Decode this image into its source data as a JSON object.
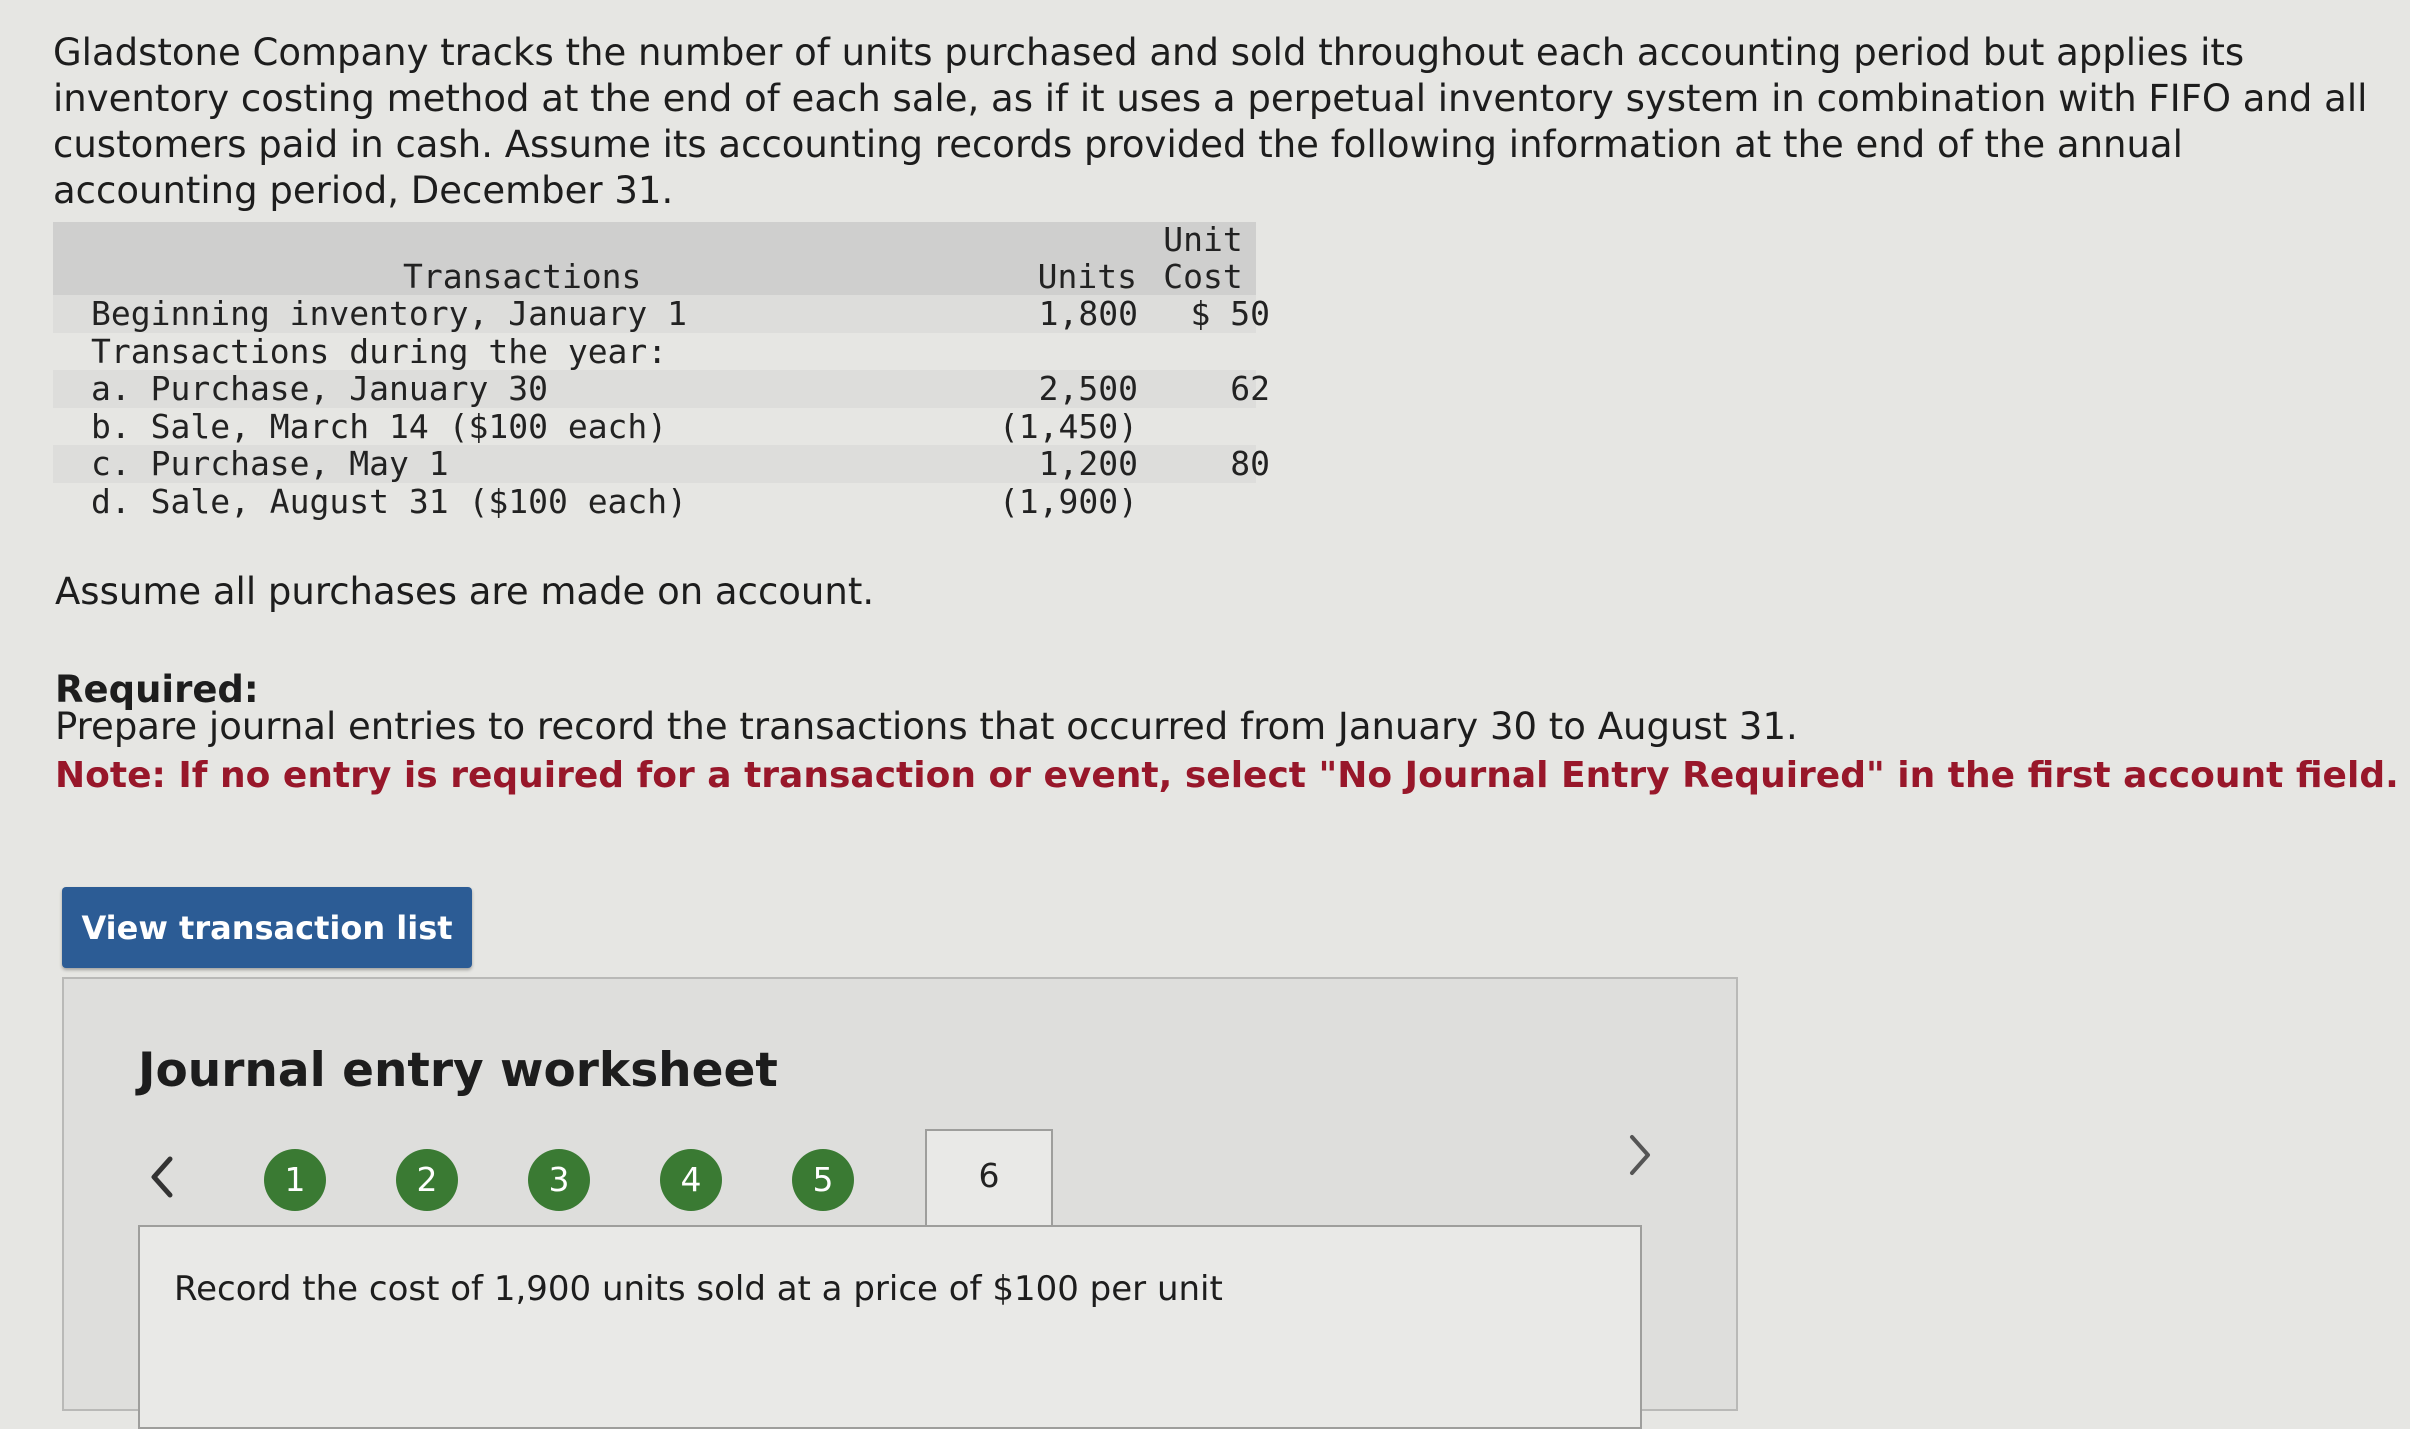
{
  "intro": "Gladstone Company tracks the number of units purchased and sold throughout each accounting period but applies its inventory costing method at the end of each sale, as if it uses a perpetual inventory system in combination with FIFO and all customers paid in cash. Assume its accounting records provided the following information at the end of the annual accounting period, December 31.",
  "table": {
    "header": {
      "transactions": "Transactions",
      "units": "Units",
      "unit_cost_line1": "Unit",
      "unit_cost_line2": "Cost"
    },
    "rows": [
      {
        "label": "Beginning inventory, January 1",
        "units": "1,800",
        "cost": "$ 50"
      },
      {
        "label": "Transactions during the year:",
        "units": "",
        "cost": ""
      },
      {
        "label": "a. Purchase, January 30",
        "units": "2,500",
        "cost": "62"
      },
      {
        "label": "b. Sale, March 14 ($100 each)",
        "units": "(1,450)",
        "cost": ""
      },
      {
        "label": "c. Purchase, May 1",
        "units": "1,200",
        "cost": "80"
      },
      {
        "label": "d. Sale, August 31 ($100 each)",
        "units": "(1,900)",
        "cost": ""
      }
    ]
  },
  "assume": "Assume all purchases are made on account.",
  "required_title": "Required:",
  "required_text": "Prepare journal entries to record the transactions that occurred from January 30 to August 31.",
  "note": "Note: If no entry is required for a transaction or event, select \"No Journal Entry Required\" in the first account field.",
  "view_button": "View transaction list",
  "worksheet": {
    "title": "Journal entry worksheet",
    "prev_icon": "chevron-left-icon",
    "next_icon": "chevron-right-icon",
    "steps": [
      "1",
      "2",
      "3",
      "4",
      "5"
    ],
    "active_step": "6",
    "instruction": "Record the cost of 1,900 units sold at a price of $100 per unit"
  }
}
